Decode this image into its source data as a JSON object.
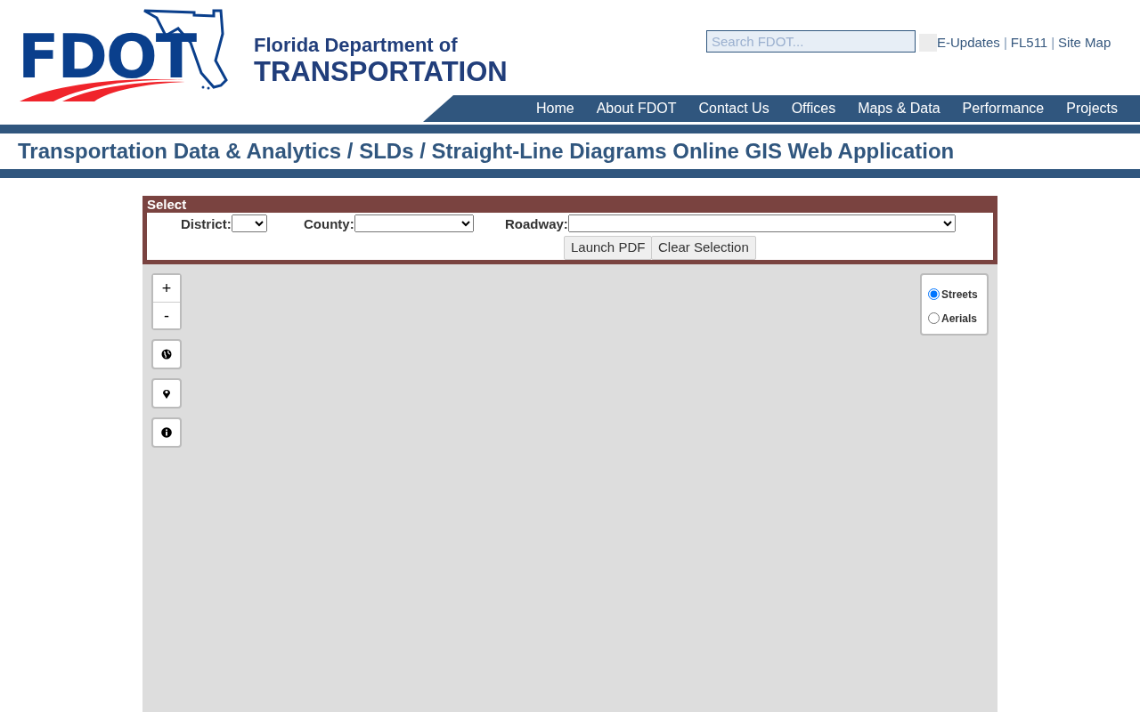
{
  "logo": {
    "text": "FDOT"
  },
  "agency": {
    "line1": "Florida Department of",
    "line2": "TRANSPORTATION"
  },
  "search": {
    "placeholder": "Search FDOT..."
  },
  "utility_links": [
    {
      "kind": "link",
      "label": "E-Updates"
    },
    {
      "kind": "separator",
      "label": "|"
    },
    {
      "kind": "link",
      "label": "FL511"
    },
    {
      "kind": "separator",
      "label": "|"
    },
    {
      "kind": "link",
      "label": "Site Map"
    }
  ],
  "nav": [
    "Home",
    "About FDOT",
    "Contact Us",
    "Offices",
    "Maps & Data",
    "Performance",
    "Projects"
  ],
  "breadcrumb": "Transportation Data & Analytics / SLDs / Straight-Line Diagrams Online GIS Web Application",
  "select_panel": {
    "title": "Select",
    "fields": [
      {
        "label": "District:"
      },
      {
        "label": "County:"
      },
      {
        "label": "Roadway:"
      }
    ],
    "buttons": [
      "Launch PDF",
      "Clear Selection"
    ]
  },
  "map": {
    "zoom_in": "+",
    "zoom_out": "-",
    "tools": [
      {
        "kind": "globe"
      },
      {
        "kind": "pin"
      },
      {
        "kind": "info"
      }
    ],
    "layers": [
      {
        "label": "Streets",
        "selected": true
      },
      {
        "label": "Aerials",
        "selected": false
      }
    ]
  }
}
